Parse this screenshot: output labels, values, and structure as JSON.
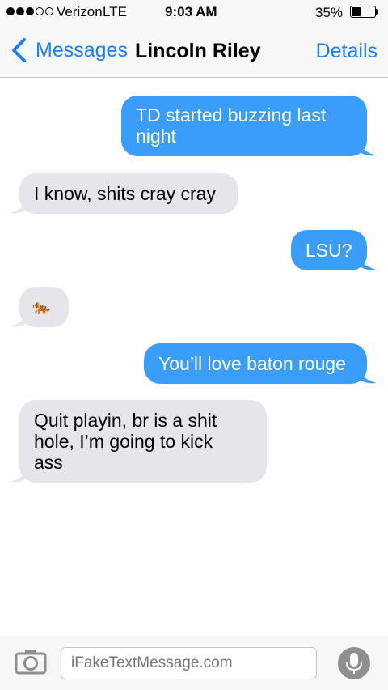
{
  "status_bar": {
    "carrier": "Verizon",
    "network": "LTE",
    "time": "9:03 AM",
    "battery_percent": "35%",
    "battery_level": 0.35,
    "signal_bars_filled": 3,
    "signal_bars_total": 5
  },
  "nav": {
    "back_label": "Messages",
    "title": "Lincoln Riley",
    "details_label": "Details"
  },
  "messages": [
    {
      "direction": "outgoing",
      "text": "TD started buzzing last\nnight"
    },
    {
      "direction": "incoming",
      "text": "I know, shits cray cray"
    },
    {
      "direction": "outgoing",
      "text": "LSU?"
    },
    {
      "direction": "incoming",
      "text": "🐅"
    },
    {
      "direction": "outgoing",
      "text": "You’ll love baton rouge"
    },
    {
      "direction": "incoming",
      "text": "Quit playin, br is a shit\nhole, I’m going to kick\nass"
    }
  ],
  "composer": {
    "placeholder": "iFakeTextMessage.com",
    "camera_icon": "camera-icon",
    "mic_icon": "microphone-icon"
  },
  "colors": {
    "accent": "#1a7ff6",
    "outgoing_bubble": "#3a9df8",
    "incoming_bubble": "#e6e5eb"
  }
}
